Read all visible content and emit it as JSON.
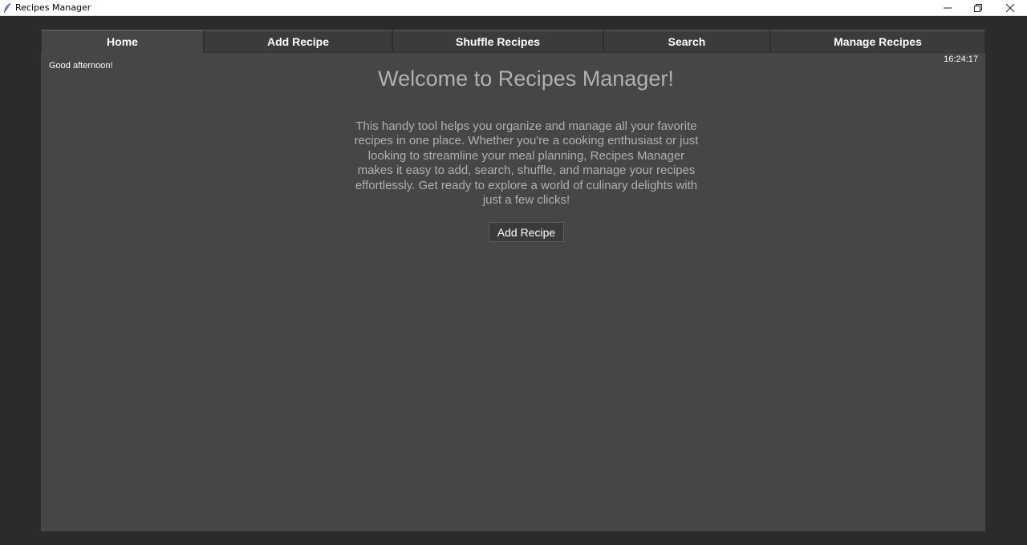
{
  "window": {
    "title": "Recipes Manager",
    "icons": {
      "app": "feather-icon",
      "minimize": "minimize-icon",
      "maximize": "restore-icon",
      "close": "close-icon"
    }
  },
  "tabs": [
    {
      "label": "Home",
      "active": true
    },
    {
      "label": "Add Recipe",
      "active": false
    },
    {
      "label": "Shuffle Recipes",
      "active": false
    },
    {
      "label": "Search",
      "active": false
    },
    {
      "label": "Manage Recipes",
      "active": false
    }
  ],
  "home": {
    "greeting": "Good afternoon!",
    "clock": "16:24:17",
    "welcome_title": "Welcome to Recipes Manager!",
    "description": "This handy tool helps you organize and manage all your favorite recipes in one place. Whether you're a cooking enthusiast or just looking to streamline your meal planning, Recipes Manager makes it easy to add, search, shuffle, and manage your recipes effortlessly. Get ready to explore a world of culinary delights with just a few clicks!",
    "add_button_label": "Add Recipe"
  },
  "colors": {
    "background": "#2b2b2b",
    "panel": "#464646",
    "tab_inactive": "#3b3b3b",
    "text_muted": "#b0b0b0",
    "text_white": "#ffffff"
  }
}
